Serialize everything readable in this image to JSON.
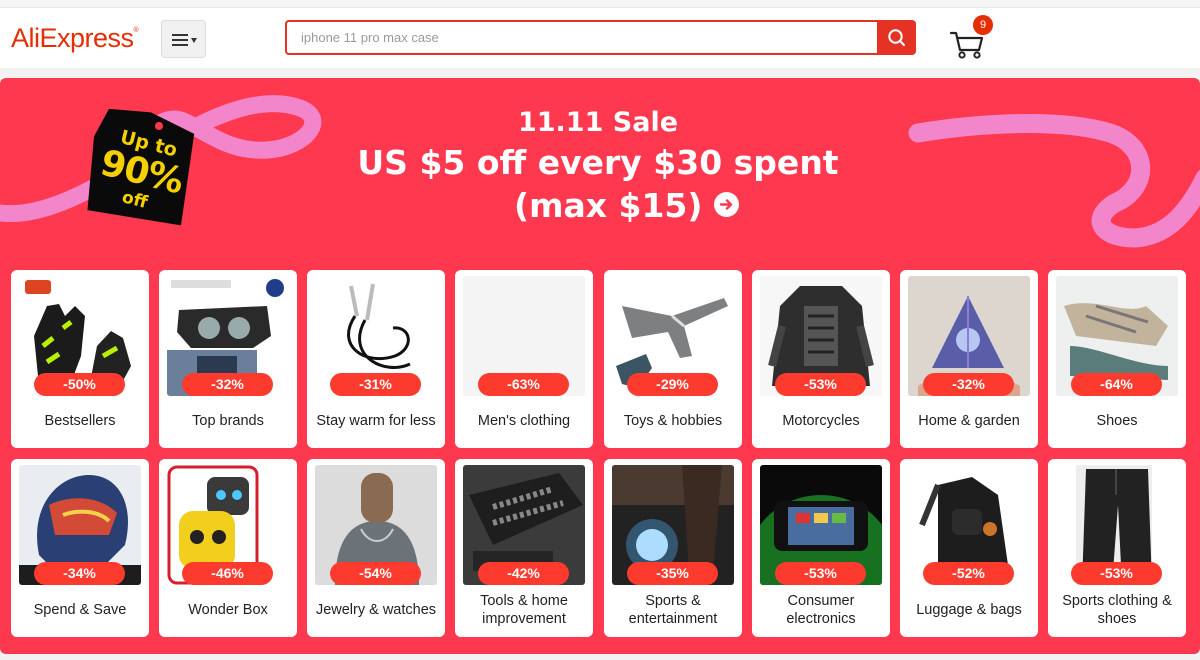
{
  "header": {
    "logo": "AliExpress",
    "logo_mark": "®",
    "search_placeholder": "iphone 11 pro max case",
    "cart_count": "9"
  },
  "banner": {
    "tag": {
      "line1": "Up to",
      "line2": "90%",
      "line3": "off"
    },
    "title": "11.11 Sale",
    "line2": "US $5 off every $30 spent",
    "line3": "(max $15)"
  },
  "colors": {
    "brand": "#e62e04",
    "panel": "#fd384f",
    "badge": "#fd3a2e",
    "ribbon": "#f28ad2"
  },
  "categories": [
    {
      "label": "Bestsellers",
      "discount": "-50%",
      "icon": "gloves-icon"
    },
    {
      "label": "Top brands",
      "discount": "-32%",
      "icon": "headlight-icon"
    },
    {
      "label": "Stay warm for less",
      "discount": "-31%",
      "icon": "cable-icon"
    },
    {
      "label": "Men's clothing",
      "discount": "-63%",
      "icon": "blank-image"
    },
    {
      "label": "Toys & hobbies",
      "discount": "-29%",
      "icon": "airplane-icon"
    },
    {
      "label": "Motorcycles",
      "discount": "-53%",
      "icon": "armor-icon"
    },
    {
      "label": "Home & garden",
      "discount": "-32%",
      "icon": "pyramid-icon"
    },
    {
      "label": "Shoes",
      "discount": "-64%",
      "icon": "sneaker-icon"
    },
    {
      "label": "Spend & Save",
      "discount": "-34%",
      "icon": "helmet-icon"
    },
    {
      "label": "Wonder Box",
      "discount": "-46%",
      "icon": "robot-icon"
    },
    {
      "label": "Jewelry & watches",
      "discount": "-54%",
      "icon": "necklace-icon"
    },
    {
      "label": "Tools & home improvement",
      "discount": "-42%",
      "icon": "toolkit-icon"
    },
    {
      "label": "Sports & entertainment",
      "discount": "-35%",
      "icon": "light-icon"
    },
    {
      "label": "Consumer electronics",
      "discount": "-53%",
      "icon": "gamepad-icon"
    },
    {
      "label": "Luggage & bags",
      "discount": "-52%",
      "icon": "bag-icon"
    },
    {
      "label": "Sports clothing & shoes",
      "discount": "-53%",
      "icon": "pants-icon"
    }
  ]
}
